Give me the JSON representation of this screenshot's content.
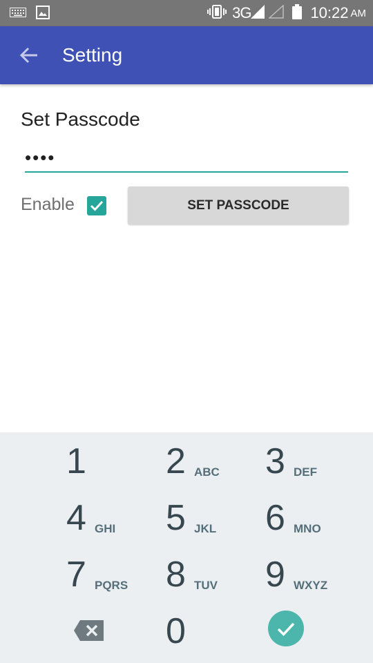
{
  "status_bar": {
    "network": "3G",
    "time": "10:22",
    "ampm": "AM",
    "icons": [
      "keyboard-icon",
      "image-icon",
      "vibrate-icon",
      "signal-icon",
      "signal-empty-icon",
      "battery-icon"
    ]
  },
  "app_bar": {
    "title": "Setting",
    "color": "#3f51b5"
  },
  "form": {
    "section_title": "Set Passcode",
    "passcode_value": "••••",
    "enable_label": "Enable",
    "enable_checked": true,
    "set_button_label": "SET PASSCODE",
    "accent_color": "#26a69a"
  },
  "keypad": {
    "keys": [
      {
        "digit": "1",
        "letters": ""
      },
      {
        "digit": "2",
        "letters": "ABC"
      },
      {
        "digit": "3",
        "letters": "DEF"
      },
      {
        "digit": "4",
        "letters": "GHI"
      },
      {
        "digit": "5",
        "letters": "JKL"
      },
      {
        "digit": "6",
        "letters": "MNO"
      },
      {
        "digit": "7",
        "letters": "PQRS"
      },
      {
        "digit": "8",
        "letters": "TUV"
      },
      {
        "digit": "9",
        "letters": "WXYZ"
      },
      {
        "digit": "0",
        "letters": ""
      }
    ]
  }
}
